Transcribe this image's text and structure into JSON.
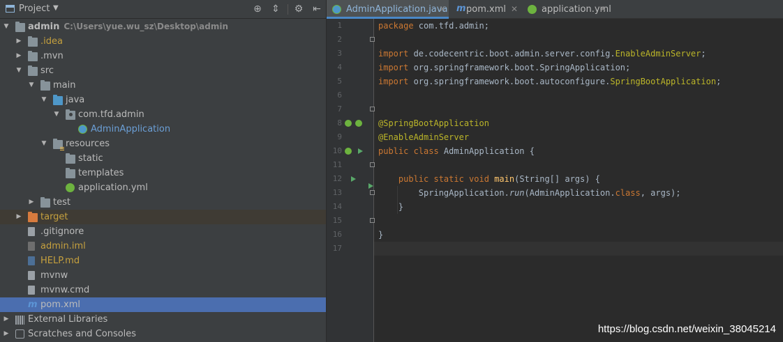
{
  "project_panel": {
    "title": "Project",
    "toolbar_icons": [
      "crosshair-icon",
      "collapse-all-icon",
      "gear-icon",
      "hide-icon"
    ]
  },
  "tree": [
    {
      "name": "admin",
      "extra": "C:\\Users\\yue.wu_sz\\Desktop\\admin",
      "depth": 0,
      "expanded": true,
      "icon": "folder",
      "color": "#bbbbbb",
      "bold": true
    },
    {
      "name": ".idea",
      "depth": 1,
      "expanded": false,
      "icon": "folder",
      "color": "#c5a03e"
    },
    {
      "name": ".mvn",
      "depth": 1,
      "expanded": false,
      "icon": "folder",
      "color": "#bbbbbb"
    },
    {
      "name": "src",
      "depth": 1,
      "expanded": true,
      "icon": "folder",
      "color": "#bbbbbb"
    },
    {
      "name": "main",
      "depth": 2,
      "expanded": true,
      "icon": "folder",
      "color": "#bbbbbb"
    },
    {
      "name": "java",
      "depth": 3,
      "expanded": true,
      "icon": "folder-blue",
      "color": "#bbbbbb"
    },
    {
      "name": "com.tfd.admin",
      "depth": 4,
      "expanded": true,
      "icon": "package",
      "color": "#bbbbbb"
    },
    {
      "name": "AdminApplication",
      "depth": 5,
      "icon": "spring-class",
      "color": "#6b9fd6"
    },
    {
      "name": "resources",
      "depth": 3,
      "expanded": true,
      "icon": "resources-folder",
      "color": "#bbbbbb"
    },
    {
      "name": "static",
      "depth": 4,
      "icon": "folder",
      "color": "#bbbbbb"
    },
    {
      "name": "templates",
      "depth": 4,
      "icon": "folder",
      "color": "#bbbbbb"
    },
    {
      "name": "application.yml",
      "depth": 4,
      "icon": "spring-yml",
      "color": "#bbbbbb"
    },
    {
      "name": "test",
      "depth": 2,
      "expanded": false,
      "icon": "folder",
      "color": "#bbbbbb"
    },
    {
      "name": "target",
      "depth": 1,
      "expanded": false,
      "icon": "folder-orange",
      "color": "#c5a03e",
      "excluded": true
    },
    {
      "name": ".gitignore",
      "depth": 1,
      "icon": "file",
      "color": "#bbbbbb"
    },
    {
      "name": "admin.iml",
      "depth": 1,
      "icon": "file-dark",
      "color": "#c5a03e"
    },
    {
      "name": "HELP.md",
      "depth": 1,
      "icon": "file-md",
      "color": "#c5a03e"
    },
    {
      "name": "mvnw",
      "depth": 1,
      "icon": "file",
      "color": "#bbbbbb"
    },
    {
      "name": "mvnw.cmd",
      "depth": 1,
      "icon": "file",
      "color": "#bbbbbb"
    },
    {
      "name": "pom.xml",
      "depth": 1,
      "icon": "maven",
      "color": "#bbbbbb",
      "selected": true
    },
    {
      "name": "External Libraries",
      "depth": 0,
      "expanded": false,
      "icon": "libraries",
      "color": "#bbbbbb"
    },
    {
      "name": "Scratches and Consoles",
      "depth": 0,
      "expanded": false,
      "icon": "scratches",
      "color": "#bbbbbb"
    }
  ],
  "tabs": [
    {
      "label": "AdminApplication.java",
      "icon": "spring-class-icon",
      "active": true
    },
    {
      "label": "pom.xml",
      "icon": "maven-icon",
      "active": false
    },
    {
      "label": "application.yml",
      "icon": "spring-yml-icon",
      "active": false
    }
  ],
  "code": {
    "line_numbers": [
      "1",
      "2",
      "3",
      "4",
      "5",
      "6",
      "7",
      "8",
      "9",
      "10",
      "11",
      "12",
      "13",
      "14",
      "15",
      "16",
      "17"
    ],
    "lines": [
      [
        [
          "kw",
          "package "
        ],
        [
          "p",
          "com.tfd.admin;"
        ]
      ],
      [],
      [
        [
          "kw",
          "import "
        ],
        [
          "p",
          "de.codecentric.boot.admin.server.config."
        ],
        [
          "ann",
          "EnableAdminServer"
        ],
        [
          "p",
          ";"
        ]
      ],
      [
        [
          "kw",
          "import "
        ],
        [
          "p",
          "org.springframework.boot.SpringApplication;"
        ]
      ],
      [
        [
          "kw",
          "import "
        ],
        [
          "p",
          "org.springframework.boot.autoconfigure."
        ],
        [
          "ann",
          "SpringBootApplication"
        ],
        [
          "p",
          ";"
        ]
      ],
      [],
      [],
      [
        [
          "ann",
          "@SpringBootApplication"
        ]
      ],
      [
        [
          "ann",
          "@EnableAdminServer"
        ]
      ],
      [
        [
          "kw",
          "public class "
        ],
        [
          "p",
          "AdminApplication {"
        ]
      ],
      [],
      [
        [
          "p",
          "    "
        ],
        [
          "kw",
          "public static void "
        ],
        [
          "fn",
          "main"
        ],
        [
          "p",
          "(String[] args) {"
        ]
      ],
      [
        [
          "p",
          "        SpringApplication."
        ],
        [
          "it",
          "run"
        ],
        [
          "p",
          "(AdminApplication."
        ],
        [
          "kw",
          "class"
        ],
        [
          "p",
          ", args);"
        ]
      ],
      [
        [
          "p",
          "    }"
        ]
      ],
      [],
      [
        [
          "p",
          "}"
        ]
      ],
      []
    ]
  },
  "watermark": "https://blog.csdn.net/weixin_38045214",
  "colors": {
    "panel_bg": "#3c3f41",
    "editor_bg": "#2b2b2b",
    "selection": "#4b6eaf",
    "keyword": "#cc7832",
    "annotation": "#bbb529",
    "method": "#ffc66d",
    "text": "#a9b7c6"
  }
}
